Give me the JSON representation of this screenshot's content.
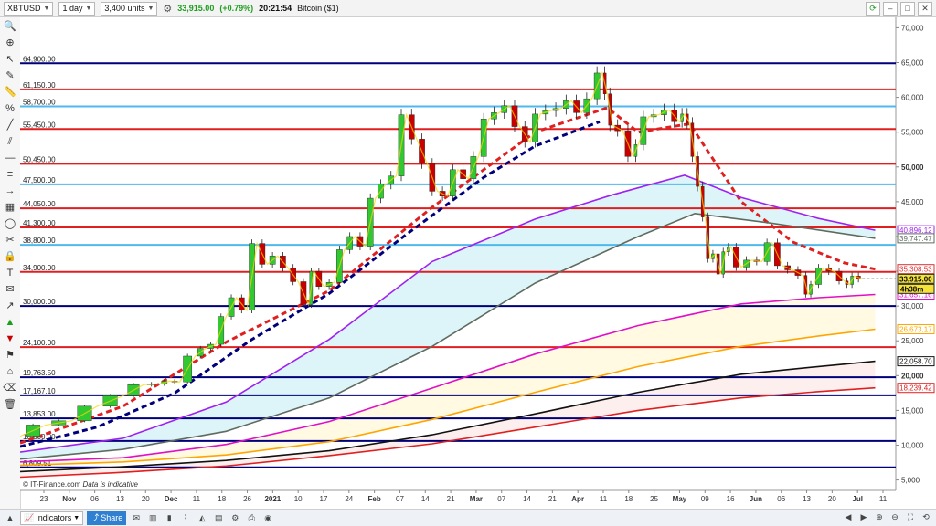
{
  "toolbar": {
    "symbol": "XBTUSD",
    "timeframe": "1 day",
    "units": "3,400 units",
    "last_price": "33,915.00",
    "change": "(+0.79%)",
    "time": "20:21:54",
    "instrument_name": "Bitcoin ($1)"
  },
  "footer": {
    "copyright": "© IT-Finance.com",
    "disclaimer": "Data is indicative",
    "indicators_label": "Indicators",
    "share_label": "Share"
  },
  "countdown": "4h38m",
  "colors": {
    "navy": "#00007a",
    "red": "#e02020",
    "lightblue": "#4fb9ec",
    "purple": "#a020f0",
    "gray": "#5f6b5f",
    "magenta": "#e010c8",
    "orange": "#ffa500",
    "black": "#111111",
    "darkred": "#e03030",
    "upcandle": "#32c832",
    "downcandle": "#c80000"
  },
  "chart_data": {
    "type": "line",
    "symbol": "XBTUSD",
    "x_ticks": [
      "23",
      "Nov",
      "06",
      "13",
      "20",
      "Dec",
      "11",
      "18",
      "26",
      "2021",
      "10",
      "17",
      "24",
      "Feb",
      "07",
      "14",
      "21",
      "Mar",
      "07",
      "14",
      "21",
      "Apr",
      "11",
      "18",
      "25",
      "May",
      "09",
      "16",
      "Jun",
      "06",
      "13",
      "20",
      "Jul",
      "11"
    ],
    "y_ticks": [
      "70,000",
      "65,000",
      "60,000",
      "55,000",
      "50,000",
      "45,000",
      "40,000",
      "35,000",
      "30,000",
      "25,000",
      "20,000",
      "15,000",
      "10,000",
      "5,000"
    ],
    "y_tick_values": [
      70000,
      65000,
      60000,
      55000,
      50000,
      45000,
      40000,
      35000,
      30000,
      25000,
      20000,
      15000,
      10000,
      5000
    ],
    "ylim": [
      3500,
      71500
    ],
    "horizontal_levels": [
      {
        "label": "64,900.00",
        "value": 64900,
        "color": "navy"
      },
      {
        "label": "61,150.00",
        "value": 61150,
        "color": "red"
      },
      {
        "label": "58,700.00",
        "value": 58700,
        "color": "lightblue"
      },
      {
        "label": "55,450.00",
        "value": 55450,
        "color": "red"
      },
      {
        "label": "50,450.00",
        "value": 50450,
        "color": "red"
      },
      {
        "label": "47,500.00",
        "value": 47500,
        "color": "lightblue"
      },
      {
        "label": "44,050.00",
        "value": 44050,
        "color": "red"
      },
      {
        "label": "41,300.00",
        "value": 41300,
        "color": "red"
      },
      {
        "label": "38,800.00",
        "value": 38800,
        "color": "lightblue"
      },
      {
        "label": "34,900.00",
        "value": 34900,
        "color": "red"
      },
      {
        "label": "30,000.00",
        "value": 30000,
        "color": "navy"
      },
      {
        "label": "24,100.00",
        "value": 24100,
        "color": "red"
      },
      {
        "label": "19,763.50",
        "value": 19763.5,
        "color": "navy"
      },
      {
        "label": "17,167.10",
        "value": 17167.1,
        "color": "navy"
      },
      {
        "label": "13,853.00",
        "value": 13853,
        "color": "navy"
      },
      {
        "label": "10,600.00",
        "value": 10600,
        "color": "navy"
      },
      {
        "label": "6,809.51",
        "value": 6809.51,
        "color": "navy"
      }
    ],
    "right_badges": [
      {
        "label": "40,896.12",
        "value": 40896.12,
        "color": "purple"
      },
      {
        "label": "39,747.47",
        "value": 39747.47,
        "color": "gray"
      },
      {
        "label": "35,308.53",
        "value": 35308.53,
        "color": "darkred"
      },
      {
        "label": "33,915.00",
        "value": 33915,
        "color": "current"
      },
      {
        "label": "31,657.16",
        "value": 31657.16,
        "color": "magenta"
      },
      {
        "label": "26,673.17",
        "value": 26673.17,
        "color": "orange"
      },
      {
        "label": "22,058.70",
        "value": 22058.7,
        "color": "black"
      },
      {
        "label": "18,239.42",
        "value": 18239.42,
        "color": "red"
      }
    ],
    "price_path": [
      [
        0,
        11300
      ],
      [
        10,
        12900
      ],
      [
        20,
        13500
      ],
      [
        30,
        15600
      ],
      [
        40,
        17100
      ],
      [
        48,
        18700
      ],
      [
        54,
        18800
      ],
      [
        58,
        19200
      ],
      [
        62,
        19100
      ],
      [
        68,
        22800
      ],
      [
        72,
        23900
      ],
      [
        76,
        24500
      ],
      [
        80,
        28500
      ],
      [
        84,
        31200
      ],
      [
        88,
        29400
      ],
      [
        92,
        39000
      ],
      [
        96,
        36000
      ],
      [
        100,
        37200
      ],
      [
        104,
        35500
      ],
      [
        108,
        33500
      ],
      [
        112,
        30200
      ],
      [
        114,
        35000
      ],
      [
        118,
        32800
      ],
      [
        122,
        33400
      ],
      [
        126,
        38100
      ],
      [
        130,
        40000
      ],
      [
        134,
        38600
      ],
      [
        138,
        45500
      ],
      [
        142,
        47500
      ],
      [
        146,
        48700
      ],
      [
        150,
        57500
      ],
      [
        154,
        54000
      ],
      [
        158,
        50500
      ],
      [
        162,
        46500
      ],
      [
        166,
        45800
      ],
      [
        170,
        49600
      ],
      [
        174,
        48300
      ],
      [
        178,
        51500
      ],
      [
        182,
        56900
      ],
      [
        186,
        57800
      ],
      [
        190,
        58800
      ],
      [
        194,
        55800
      ],
      [
        198,
        53600
      ],
      [
        202,
        57600
      ],
      [
        206,
        58100
      ],
      [
        210,
        58400
      ],
      [
        214,
        59500
      ],
      [
        218,
        57800
      ],
      [
        222,
        59800
      ],
      [
        226,
        63500
      ],
      [
        228,
        60500
      ],
      [
        230,
        56000
      ],
      [
        234,
        55200
      ],
      [
        238,
        51500
      ],
      [
        240,
        53200
      ],
      [
        244,
        57200
      ],
      [
        248,
        57500
      ],
      [
        252,
        58200
      ],
      [
        256,
        56500
      ],
      [
        258,
        57600
      ],
      [
        260,
        56300
      ],
      [
        262,
        51500
      ],
      [
        264,
        47200
      ],
      [
        266,
        42800
      ],
      [
        268,
        36800
      ],
      [
        270,
        37500
      ],
      [
        272,
        34600
      ],
      [
        274,
        37800
      ],
      [
        276,
        38500
      ],
      [
        280,
        35600
      ],
      [
        284,
        36600
      ],
      [
        288,
        36400
      ],
      [
        292,
        39100
      ],
      [
        296,
        35800
      ],
      [
        300,
        35200
      ],
      [
        304,
        34400
      ],
      [
        306,
        31700
      ],
      [
        308,
        33100
      ],
      [
        312,
        35500
      ],
      [
        316,
        35000
      ],
      [
        320,
        33600
      ],
      [
        322,
        33100
      ],
      [
        324,
        34300
      ],
      [
        327,
        33915
      ]
    ],
    "x_range": [
      0,
      340
    ],
    "moving_averages": [
      {
        "color": "red",
        "dashed": true,
        "points": [
          [
            0,
            10300
          ],
          [
            40,
            15600
          ],
          [
            80,
            24800
          ],
          [
            120,
            32200
          ],
          [
            160,
            44200
          ],
          [
            200,
            55000
          ],
          [
            228,
            58500
          ],
          [
            240,
            55000
          ],
          [
            260,
            56200
          ],
          [
            280,
            45000
          ],
          [
            300,
            39200
          ],
          [
            320,
            36200
          ],
          [
            332,
            35308
          ]
        ]
      },
      {
        "color": "navy",
        "dashed": true,
        "points": [
          [
            0,
            9800
          ],
          [
            30,
            12600
          ],
          [
            60,
            17500
          ],
          [
            90,
            25200
          ],
          [
            120,
            31800
          ],
          [
            150,
            40300
          ],
          [
            180,
            48500
          ],
          [
            200,
            53000
          ],
          [
            225,
            56500
          ]
        ]
      },
      {
        "color": "purple",
        "dashed": false,
        "points": [
          [
            0,
            9000
          ],
          [
            40,
            11000
          ],
          [
            80,
            16200
          ],
          [
            120,
            25200
          ],
          [
            160,
            36400
          ],
          [
            200,
            42500
          ],
          [
            230,
            46000
          ],
          [
            258,
            48800
          ],
          [
            280,
            45600
          ],
          [
            310,
            42600
          ],
          [
            332,
            40896
          ]
        ]
      },
      {
        "color": "gray",
        "dashed": false,
        "points": [
          [
            0,
            8000
          ],
          [
            40,
            9400
          ],
          [
            80,
            12000
          ],
          [
            120,
            16800
          ],
          [
            160,
            24200
          ],
          [
            200,
            33300
          ],
          [
            240,
            40000
          ],
          [
            262,
            43300
          ],
          [
            290,
            42000
          ],
          [
            332,
            39747
          ]
        ]
      },
      {
        "color": "magenta",
        "dashed": false,
        "points": [
          [
            0,
            7600
          ],
          [
            40,
            8200
          ],
          [
            80,
            10100
          ],
          [
            120,
            13400
          ],
          [
            160,
            18200
          ],
          [
            200,
            23100
          ],
          [
            240,
            27200
          ],
          [
            280,
            30300
          ],
          [
            310,
            31200
          ],
          [
            332,
            31657
          ]
        ]
      },
      {
        "color": "orange",
        "dashed": false,
        "points": [
          [
            0,
            7100
          ],
          [
            40,
            7600
          ],
          [
            80,
            8600
          ],
          [
            120,
            10500
          ],
          [
            160,
            13700
          ],
          [
            200,
            17600
          ],
          [
            240,
            21300
          ],
          [
            280,
            24200
          ],
          [
            310,
            25700
          ],
          [
            332,
            26673
          ]
        ]
      },
      {
        "color": "black",
        "dashed": false,
        "points": [
          [
            0,
            6200
          ],
          [
            40,
            6900
          ],
          [
            80,
            7800
          ],
          [
            120,
            9200
          ],
          [
            160,
            11500
          ],
          [
            200,
            14500
          ],
          [
            240,
            17600
          ],
          [
            280,
            20200
          ],
          [
            310,
            21300
          ],
          [
            332,
            22058
          ]
        ]
      },
      {
        "color": "red",
        "dashed": false,
        "points": [
          [
            0,
            5400
          ],
          [
            40,
            6100
          ],
          [
            80,
            7000
          ],
          [
            120,
            8500
          ],
          [
            160,
            10200
          ],
          [
            200,
            12600
          ],
          [
            240,
            15000
          ],
          [
            280,
            16800
          ],
          [
            310,
            17700
          ],
          [
            332,
            18239
          ]
        ]
      }
    ]
  }
}
